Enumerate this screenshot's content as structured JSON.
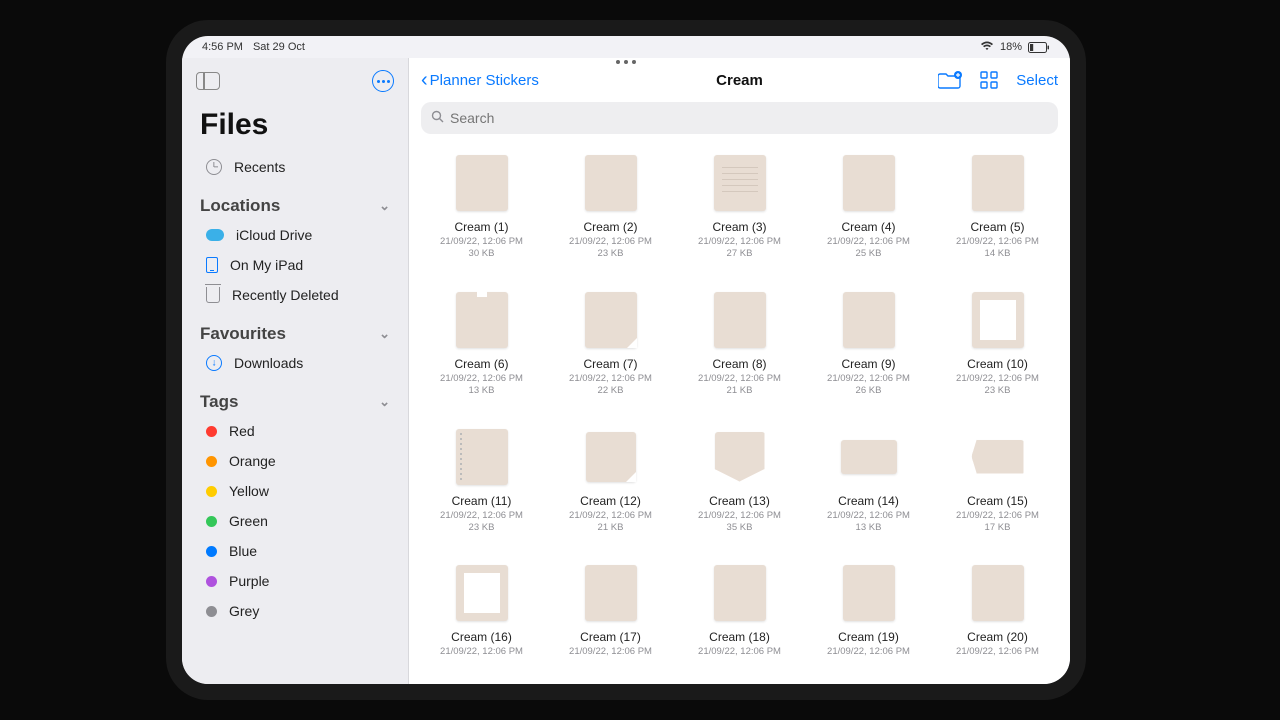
{
  "status": {
    "time": "4:56 PM",
    "date": "Sat 29 Oct",
    "battery_pct": "18%"
  },
  "sidebar": {
    "app_title": "Files",
    "recents": "Recents",
    "sections": {
      "locations": {
        "title": "Locations",
        "items": [
          {
            "label": "iCloud Drive"
          },
          {
            "label": "On My iPad"
          },
          {
            "label": "Recently Deleted"
          }
        ]
      },
      "favourites": {
        "title": "Favourites",
        "items": [
          {
            "label": "Downloads"
          }
        ]
      },
      "tags": {
        "title": "Tags",
        "items": [
          {
            "label": "Red",
            "color": "#ff3b30"
          },
          {
            "label": "Orange",
            "color": "#ff9500"
          },
          {
            "label": "Yellow",
            "color": "#ffcc00"
          },
          {
            "label": "Green",
            "color": "#34c759"
          },
          {
            "label": "Blue",
            "color": "#007aff"
          },
          {
            "label": "Purple",
            "color": "#af52de"
          },
          {
            "label": "Grey",
            "color": "#8e8e93"
          }
        ]
      }
    }
  },
  "toolbar": {
    "back_label": "Planner Stickers",
    "title": "Cream",
    "select_label": "Select"
  },
  "search": {
    "placeholder": "Search"
  },
  "files": [
    {
      "name": "Cream (1)",
      "date": "21/09/22, 12:06 PM",
      "size": "30 KB",
      "shape": "plain"
    },
    {
      "name": "Cream (2)",
      "date": "21/09/22, 12:06 PM",
      "size": "23 KB",
      "shape": "plain"
    },
    {
      "name": "Cream (3)",
      "date": "21/09/22, 12:06 PM",
      "size": "27 KB",
      "shape": "lines"
    },
    {
      "name": "Cream (4)",
      "date": "21/09/22, 12:06 PM",
      "size": "25 KB",
      "shape": "plain"
    },
    {
      "name": "Cream (5)",
      "date": "21/09/22, 12:06 PM",
      "size": "14 KB",
      "shape": "plain"
    },
    {
      "name": "Cream (6)",
      "date": "21/09/22, 12:06 PM",
      "size": "13 KB",
      "shape": "notch"
    },
    {
      "name": "Cream (7)",
      "date": "21/09/22, 12:06 PM",
      "size": "22 KB",
      "shape": "corner"
    },
    {
      "name": "Cream (8)",
      "date": "21/09/22, 12:06 PM",
      "size": "21 KB",
      "shape": "plain"
    },
    {
      "name": "Cream (9)",
      "date": "21/09/22, 12:06 PM",
      "size": "26 KB",
      "shape": "plain"
    },
    {
      "name": "Cream (10)",
      "date": "21/09/22, 12:06 PM",
      "size": "23 KB",
      "shape": "frame"
    },
    {
      "name": "Cream (11)",
      "date": "21/09/22, 12:06 PM",
      "size": "23 KB",
      "shape": "spiral"
    },
    {
      "name": "Cream (12)",
      "date": "21/09/22, 12:06 PM",
      "size": "21 KB",
      "shape": "square corner"
    },
    {
      "name": "Cream (13)",
      "date": "21/09/22, 12:06 PM",
      "size": "35 KB",
      "shape": "square pennant"
    },
    {
      "name": "Cream (14)",
      "date": "21/09/22, 12:06 PM",
      "size": "13 KB",
      "shape": "wide"
    },
    {
      "name": "Cream (15)",
      "date": "21/09/22, 12:06 PM",
      "size": "17 KB",
      "shape": "wide tag"
    },
    {
      "name": "Cream (16)",
      "date": "21/09/22, 12:06 PM",
      "size": "",
      "shape": "frame"
    },
    {
      "name": "Cream (17)",
      "date": "21/09/22, 12:06 PM",
      "size": "",
      "shape": "plain"
    },
    {
      "name": "Cream (18)",
      "date": "21/09/22, 12:06 PM",
      "size": "",
      "shape": "plain"
    },
    {
      "name": "Cream (19)",
      "date": "21/09/22, 12:06 PM",
      "size": "",
      "shape": "plain"
    },
    {
      "name": "Cream (20)",
      "date": "21/09/22, 12:06 PM",
      "size": "",
      "shape": "plain"
    }
  ]
}
